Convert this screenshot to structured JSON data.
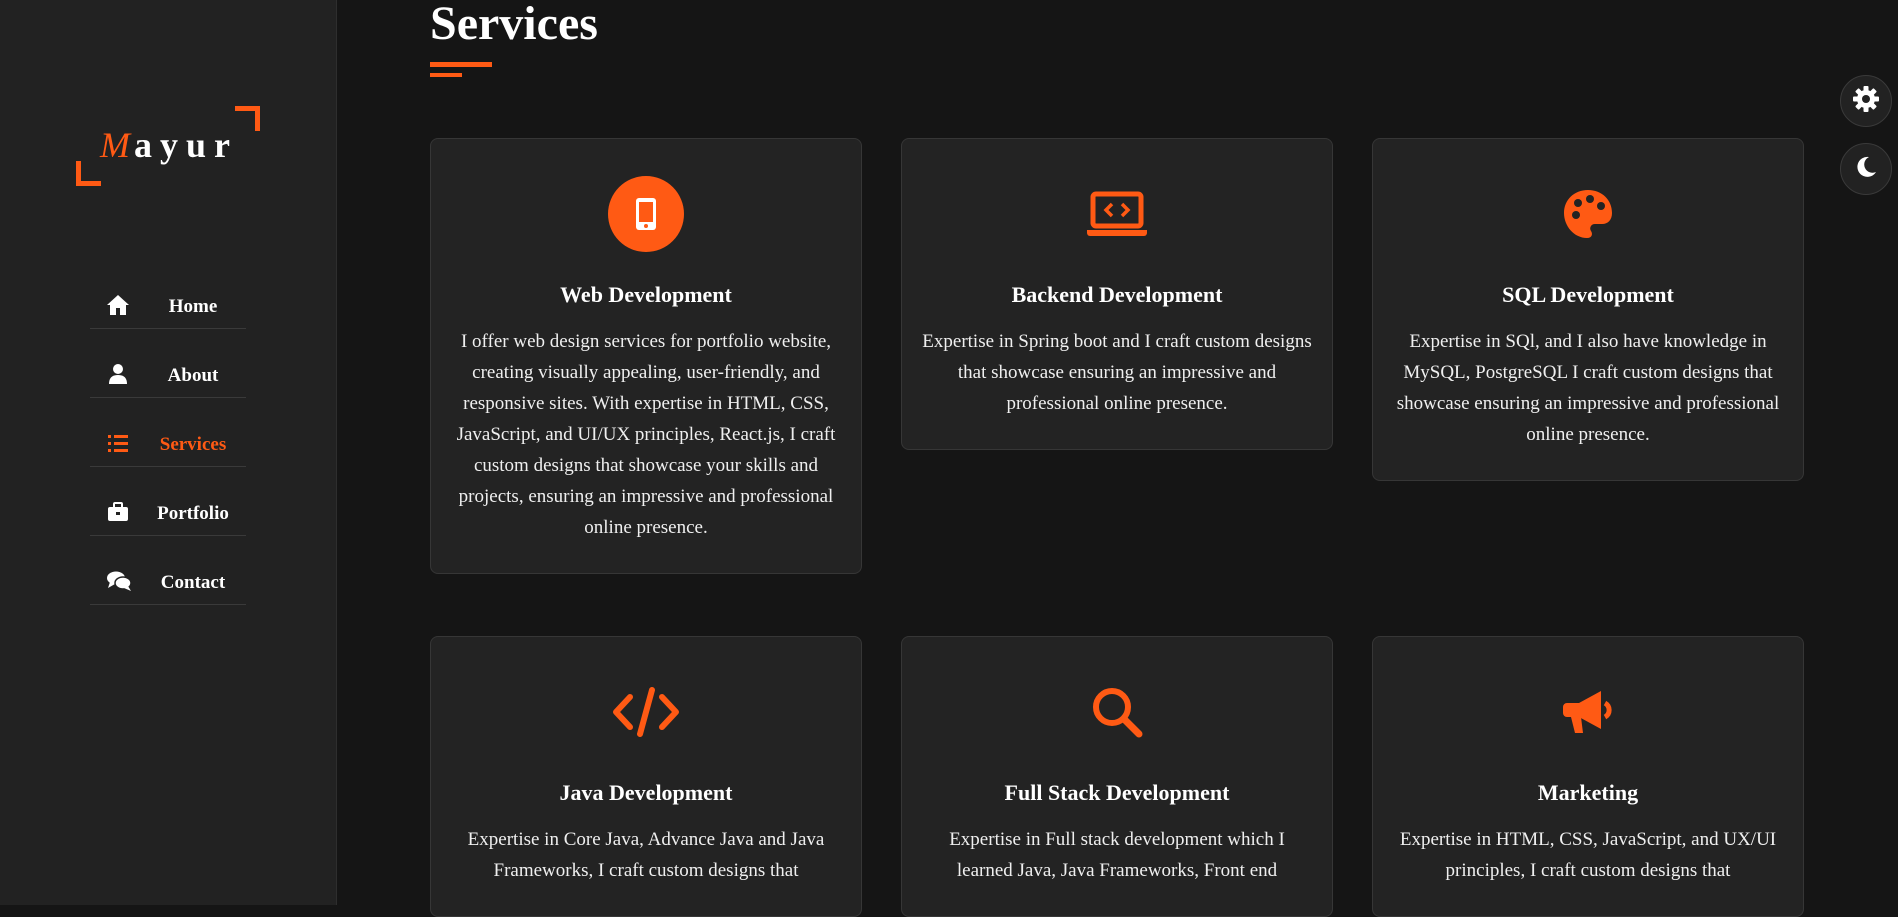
{
  "sidebar": {
    "logo": {
      "first_letter": "M",
      "rest": "ayur"
    },
    "nav": [
      {
        "label": "Home",
        "icon": "home-icon",
        "active": false
      },
      {
        "label": "About",
        "icon": "user-icon",
        "active": false
      },
      {
        "label": "Services",
        "icon": "list-icon",
        "active": true
      },
      {
        "label": "Portfolio",
        "icon": "briefcase-icon",
        "active": false
      },
      {
        "label": "Contact",
        "icon": "comments-icon",
        "active": false
      }
    ]
  },
  "main": {
    "title": "Services",
    "cards": [
      {
        "icon": "mobile-icon",
        "title": "Web Development",
        "text": "I offer web design services for portfolio website, creating visually appealing, user-friendly, and responsive sites. With expertise in HTML, CSS, JavaScript, and UI/UX principles, React.js, I craft custom designs that showcase your skills and projects, ensuring an impressive and professional online presence."
      },
      {
        "icon": "laptop-code-icon",
        "title": "Backend Development",
        "text": "Expertise in Spring boot and I craft custom designs that showcase ensuring an impressive and professional online presence."
      },
      {
        "icon": "palette-icon",
        "title": "SQL Development",
        "text": "Expertise in SQl, and I also have knowledge in MySQL, PostgreSQL I craft custom designs that showcase ensuring an impressive and professional online presence."
      },
      {
        "icon": "code-icon",
        "title": "Java Development",
        "text": "Expertise in Core Java, Advance Java and Java Frameworks, I craft custom designs that"
      },
      {
        "icon": "search-icon",
        "title": "Full Stack Development",
        "text": "Expertise in Full stack development which I learned Java, Java Frameworks, Front end"
      },
      {
        "icon": "bullhorn-icon",
        "title": "Marketing",
        "text": "Expertise in HTML, CSS, JavaScript, and UX/UI principles, I craft custom designs that"
      }
    ]
  },
  "controls": {
    "settings_icon": "gear-icon",
    "theme_icon": "moon-icon"
  },
  "colors": {
    "accent": "#ff5a14",
    "background": "#151515",
    "sidebar": "#222222",
    "card": "#232323"
  }
}
